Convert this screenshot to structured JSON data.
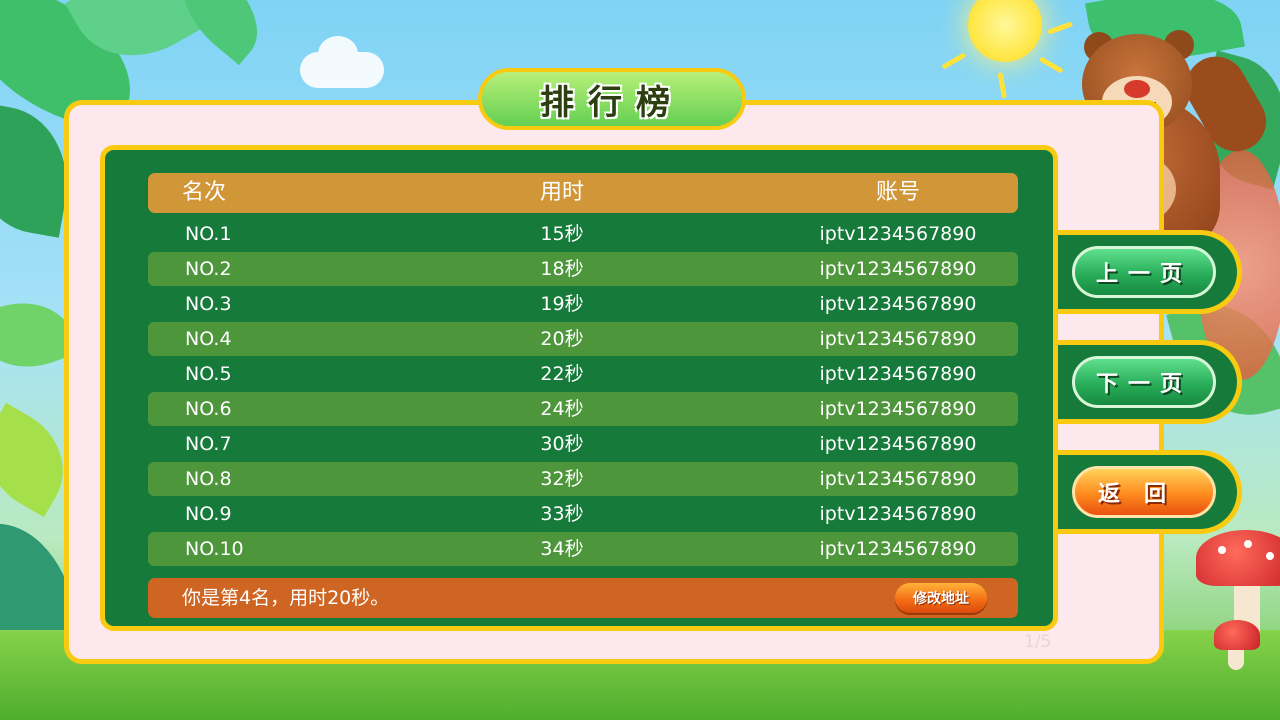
{
  "title": "排行榜",
  "table": {
    "headers": {
      "rank": "名次",
      "time": "用时",
      "account": "账号"
    },
    "rows": [
      {
        "rank": "NO.1",
        "time": "15秒",
        "account": "iptv1234567890"
      },
      {
        "rank": "NO.2",
        "time": "18秒",
        "account": "iptv1234567890"
      },
      {
        "rank": "NO.3",
        "time": "19秒",
        "account": "iptv1234567890"
      },
      {
        "rank": "NO.4",
        "time": "20秒",
        "account": "iptv1234567890"
      },
      {
        "rank": "NO.5",
        "time": "22秒",
        "account": "iptv1234567890"
      },
      {
        "rank": "NO.6",
        "time": "24秒",
        "account": "iptv1234567890"
      },
      {
        "rank": "NO.7",
        "time": "30秒",
        "account": "iptv1234567890"
      },
      {
        "rank": "NO.8",
        "time": "32秒",
        "account": "iptv1234567890"
      },
      {
        "rank": "NO.9",
        "time": "33秒",
        "account": "iptv1234567890"
      },
      {
        "rank": "NO.10",
        "time": "34秒",
        "account": "iptv1234567890"
      }
    ]
  },
  "footer": {
    "message": "你是第4名，用时20秒。",
    "modify_address_label": "修改地址"
  },
  "pagination": {
    "page_indicator": "1/5"
  },
  "nav": {
    "prev_label": "上一页",
    "next_label": "下一页",
    "back_label": "返回"
  },
  "colors": {
    "board": "#167a3a",
    "border": "#f8cb10",
    "header": "#d19637",
    "row_alt": "#4d963c",
    "footer": "#cf6522",
    "panel": "#fde8ee"
  },
  "icons": [
    "sun-icon",
    "cloud-icon",
    "bear-mascot",
    "mushroom-icon"
  ]
}
